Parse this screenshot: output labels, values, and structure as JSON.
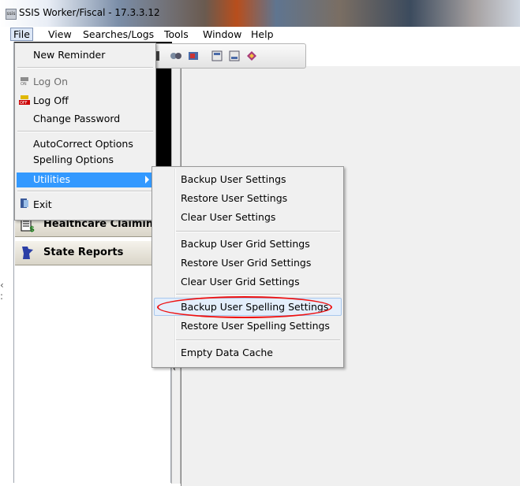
{
  "window": {
    "title": "SSIS Worker/Fiscal - 17.3.3.12",
    "app_icon": "ssis"
  },
  "menubar": [
    "File",
    "View",
    "Searches/Logs",
    "Tools",
    "Window",
    "Help"
  ],
  "file_menu": {
    "new_reminder": "New Reminder",
    "log_on": "Log On",
    "log_off": "Log Off",
    "change_password": "Change Password",
    "autocorrect": "AutoCorrect Options",
    "spelling": "Spelling Options",
    "utilities": "Utilities",
    "exit": "Exit"
  },
  "utilities_menu": {
    "backup_user": "Backup User Settings",
    "restore_user": "Restore User Settings",
    "clear_user": "Clear User Settings",
    "backup_grid": "Backup User Grid Settings",
    "restore_grid": "Restore User Grid Settings",
    "clear_grid": "Clear User Grid Settings",
    "backup_spelling": "Backup User Spelling Settings",
    "restore_spelling": "Restore User Spelling Settings",
    "empty_cache": "Empty Data Cache"
  },
  "nav": {
    "healthcare": "Healthcare Claiming",
    "state_reports": "State Reports"
  },
  "colors": {
    "highlight": "#3399ff",
    "annotation": "#e11111"
  }
}
